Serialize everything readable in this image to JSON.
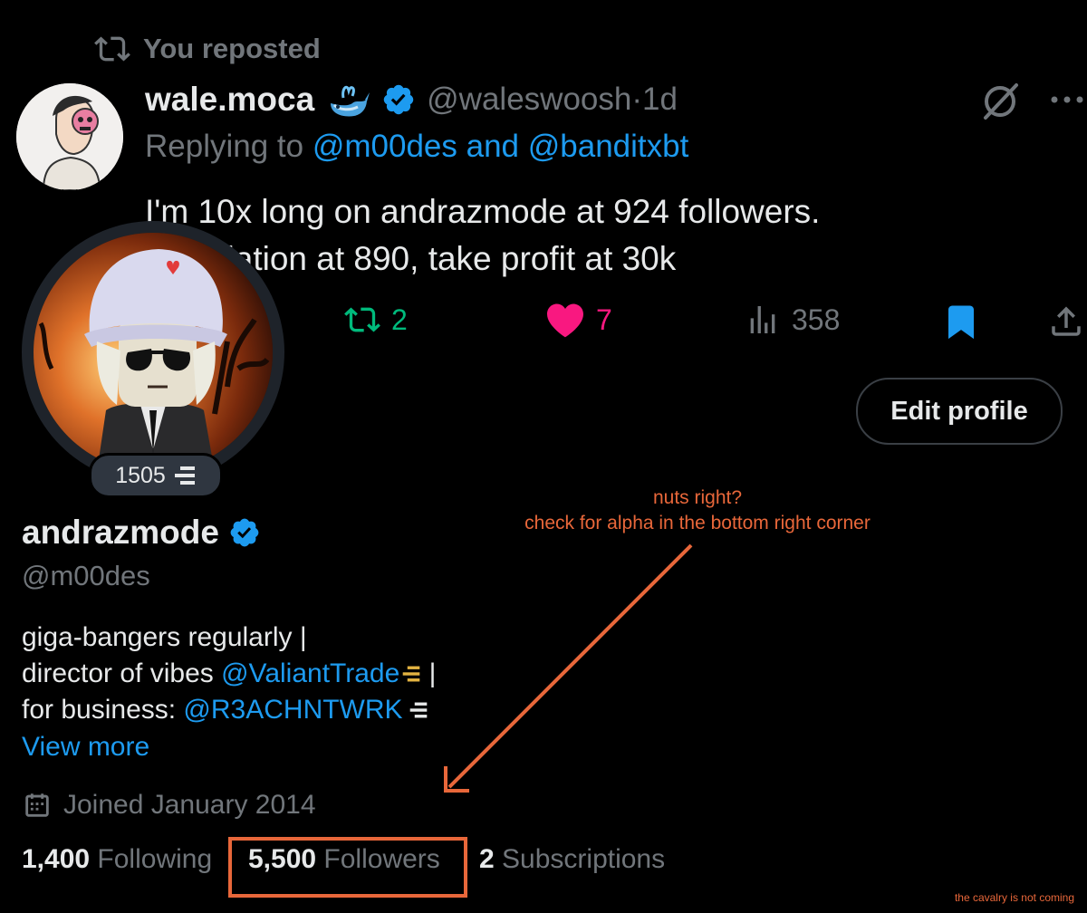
{
  "repost_header": {
    "label": "You reposted"
  },
  "tweet": {
    "display_name": "wale.moca",
    "handle": "@waleswoosh",
    "separator": "·",
    "age": "1d",
    "reply_prefix": "Replying to ",
    "reply_to_1": "@m00des",
    "reply_and": " and ",
    "reply_to_2": "@banditxbt",
    "text_line_1": "I'm 10x long on andrazmode at 924 followers.",
    "text_line_2": "Liquidation at 890, take profit at 30k",
    "actions": {
      "reposts": "2",
      "likes": "7",
      "views": "358"
    }
  },
  "profile": {
    "badge_count": "1505",
    "edit_button": "Edit profile",
    "display_name": "andrazmode",
    "handle": "@m00des",
    "bio_line_1": "giga-bangers regularly |",
    "bio_line_2_prefix": "director of vibes ",
    "bio_line_2_mention": "@ValiantTrade",
    "bio_line_2_suffix": " |",
    "bio_line_3_prefix": "for business: ",
    "bio_line_3_mention": "@R3ACHNTWRK",
    "view_more": "View more",
    "joined": "Joined January 2014",
    "stats": {
      "following_count": "1,400",
      "following_label": "Following",
      "followers_count": "5,500",
      "followers_label": "Followers",
      "subscriptions_count": "2",
      "subscriptions_label": "Subscriptions"
    }
  },
  "annotations": {
    "line_1": "nuts right?",
    "line_2": "check for alpha in the bottom right corner",
    "footer": "the cavalry is not coming",
    "color": "#e8673a"
  },
  "colors": {
    "background": "#000000",
    "accent": "#1d9bf0",
    "repost": "#00ba7c",
    "like": "#f91880",
    "muted": "#71767b"
  },
  "icons": [
    "repost-icon",
    "verified-icon",
    "whale-emoji-icon",
    "grok-icon",
    "more-icon",
    "like-icon",
    "views-icon",
    "bookmark-icon",
    "share-icon",
    "calendar-icon",
    "affiliate-badge-icon"
  ]
}
